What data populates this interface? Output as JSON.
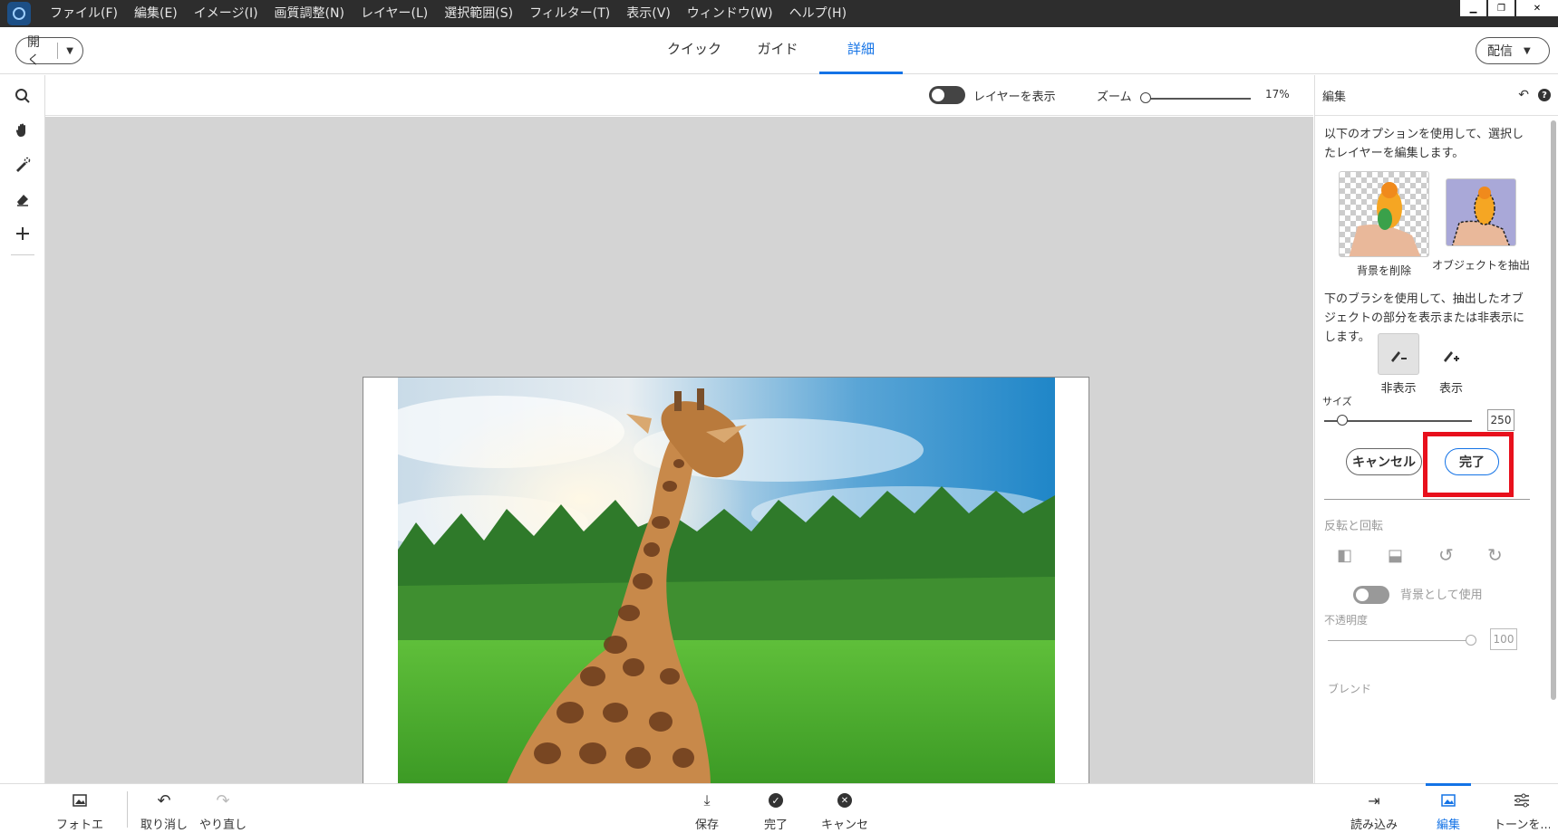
{
  "menubar": {
    "app_icon": "photoshop-elements-icon",
    "items": [
      "ファイル(F)",
      "編集(E)",
      "イメージ(I)",
      "画質調整(N)",
      "レイヤー(L)",
      "選択範囲(S)",
      "フィルター(T)",
      "表示(V)",
      "ウィンドウ(W)",
      "ヘルプ(H)"
    ]
  },
  "topbar": {
    "open_label": "開く",
    "tabs": [
      "クイック",
      "ガイド",
      "詳細"
    ],
    "active_tab": "詳細",
    "share_label": "配信"
  },
  "tools": [
    "search-icon",
    "hand-icon",
    "quick-selection-brush-icon",
    "eraser-icon",
    "plus-icon"
  ],
  "optbar": {
    "show_layer_label": "レイヤーを表示",
    "zoom_label": "ズーム",
    "zoom_value": "17%"
  },
  "panel": {
    "title": "編集",
    "intro": "以下のオプションを使用して、選択したレイヤーを編集します。",
    "remove_bg_label": "背景を削除",
    "extract_label": "オブジェクトを抽出",
    "brush_desc": "下のブラシを使用して、抽出したオブジェクトの部分を表示または非表示にします。",
    "hide_label": "非表示",
    "show_label": "表示",
    "size_label": "サイズ",
    "size_value": "250",
    "cancel_label": "キャンセル",
    "done_label": "完了",
    "flip_rotate_label": "反転と回転",
    "use_as_bg_label": "背景として使用",
    "opacity_label": "不透明度",
    "opacity_value": "100",
    "blend_label": "ブレンド",
    "highlight_color": "#e8101c"
  },
  "bottombar": {
    "photo_bin": "フォトエリア",
    "undo": "取り消し",
    "redo": "やり直し",
    "save": "保存",
    "done": "完了",
    "cancel": "キャンセル",
    "import": "読み込み",
    "edit": "編集",
    "tone": "トーンを..."
  },
  "colors": {
    "accent": "#1473e6",
    "menubar_bg": "#2d2d2d",
    "canvas_bg": "#d4d4d4"
  }
}
